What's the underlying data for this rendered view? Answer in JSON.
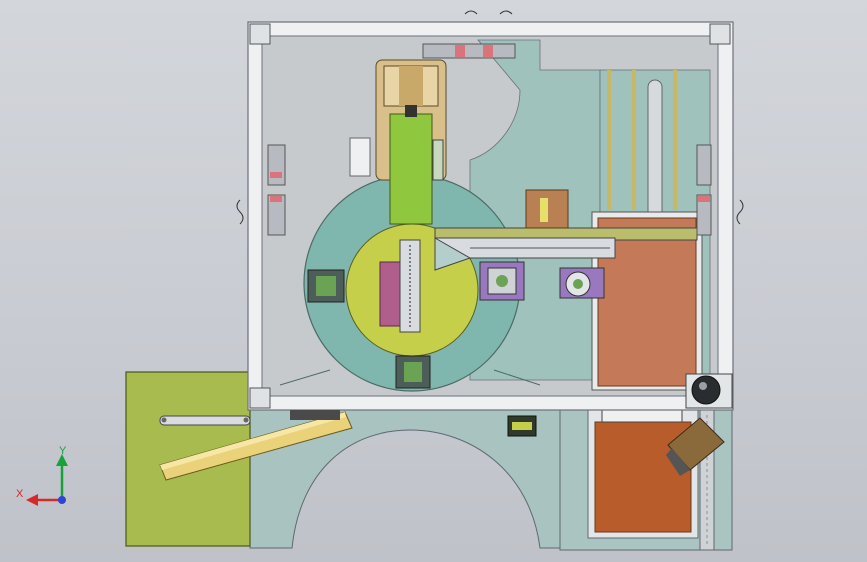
{
  "view": {
    "background_top": "#d3d6db",
    "background_bottom": "#bfc2c8"
  },
  "triad": {
    "x_label": "X",
    "y_label": "Y",
    "x_color": "#d42a2a",
    "y_color": "#19a23a",
    "z_color": "#2c44d8"
  },
  "colors": {
    "frame": "#eef0f2",
    "frame_line": "#6c7079",
    "base_plate": "#aac6c3",
    "deck": "#cdd0d3",
    "turntable": "#7fb6ad",
    "turntable_inner": "#c6cf4a",
    "green_block": "#8fc83e",
    "tan_carriage": "#d9c08b",
    "copper": "#b85d2e",
    "olive_panel": "#a6b94e",
    "gold_bar": "#e2cf72",
    "magenta": "#b0608e",
    "purple": "#9a78c0",
    "red_pad": "#d9737c",
    "brown_part": "#8a6a3a"
  }
}
